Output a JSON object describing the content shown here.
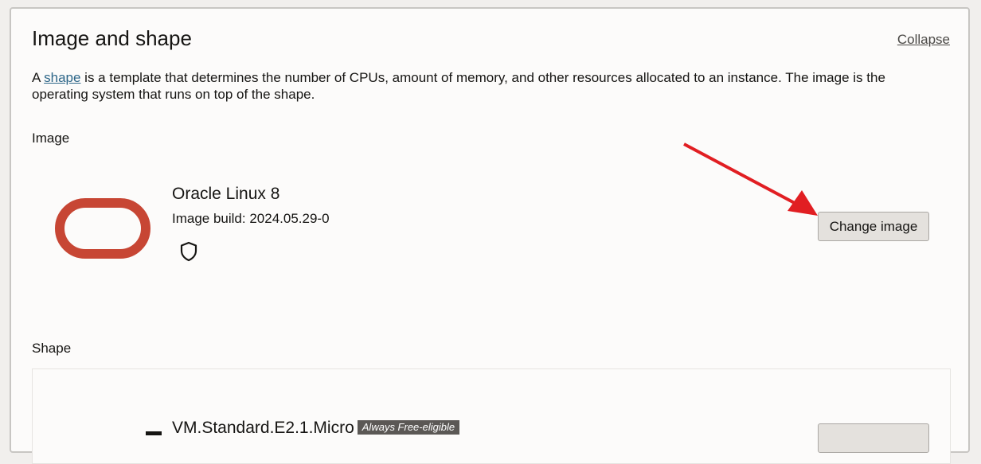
{
  "section": {
    "title": "Image and shape",
    "collapse_label": "Collapse",
    "description_prefix": "A ",
    "description_link": "shape",
    "description_suffix": " is a template that determines the number of CPUs, amount of memory, and other resources allocated to an instance. The image is the operating system that runs on top of the shape."
  },
  "image": {
    "label": "Image",
    "name": "Oracle Linux 8",
    "build": "Image build: 2024.05.29-0",
    "logo_icon": "oracle-logo-icon",
    "security_icon": "shield-icon",
    "change_button": "Change image"
  },
  "shape": {
    "label": "Shape",
    "name": "VM.Standard.E2.1.Micro",
    "badge": "Always Free-eligible",
    "logo_icon": "amd-logo-icon"
  },
  "colors": {
    "oracle_red": "#c74634",
    "annotation_arrow": "#e11e22",
    "link": "#2d6688"
  }
}
